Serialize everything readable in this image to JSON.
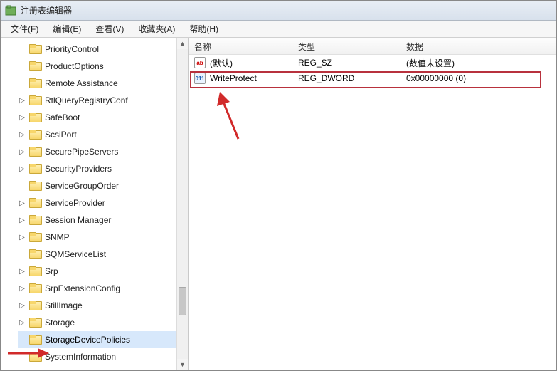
{
  "window": {
    "title": "注册表编辑器"
  },
  "menu": {
    "file": "文件(F)",
    "edit": "编辑(E)",
    "view": "查看(V)",
    "favorites": "收藏夹(A)",
    "help": "帮助(H)"
  },
  "tree": {
    "items": [
      {
        "label": "PriorityControl",
        "exp": ""
      },
      {
        "label": "ProductOptions",
        "exp": ""
      },
      {
        "label": "Remote Assistance",
        "exp": ""
      },
      {
        "label": "RtlQueryRegistryConf",
        "exp": "▷"
      },
      {
        "label": "SafeBoot",
        "exp": "▷"
      },
      {
        "label": "ScsiPort",
        "exp": "▷"
      },
      {
        "label": "SecurePipeServers",
        "exp": "▷"
      },
      {
        "label": "SecurityProviders",
        "exp": "▷"
      },
      {
        "label": "ServiceGroupOrder",
        "exp": ""
      },
      {
        "label": "ServiceProvider",
        "exp": "▷"
      },
      {
        "label": "Session Manager",
        "exp": "▷"
      },
      {
        "label": "SNMP",
        "exp": "▷"
      },
      {
        "label": "SQMServiceList",
        "exp": ""
      },
      {
        "label": "Srp",
        "exp": "▷"
      },
      {
        "label": "SrpExtensionConfig",
        "exp": "▷"
      },
      {
        "label": "StillImage",
        "exp": "▷"
      },
      {
        "label": "Storage",
        "exp": "▷"
      },
      {
        "label": "StorageDevicePolicies",
        "exp": "",
        "selected": true
      },
      {
        "label": "SystemInformation",
        "exp": ""
      }
    ]
  },
  "columns": {
    "name": "名称",
    "type": "类型",
    "data": "数据"
  },
  "values": [
    {
      "name": "(默认)",
      "icon": "ab",
      "icon_kind": "str",
      "type": "REG_SZ",
      "data": "(数值未设置)"
    },
    {
      "name": "WriteProtect",
      "icon": "011",
      "icon_kind": "dword",
      "type": "REG_DWORD",
      "data": "0x00000000 (0)"
    }
  ]
}
